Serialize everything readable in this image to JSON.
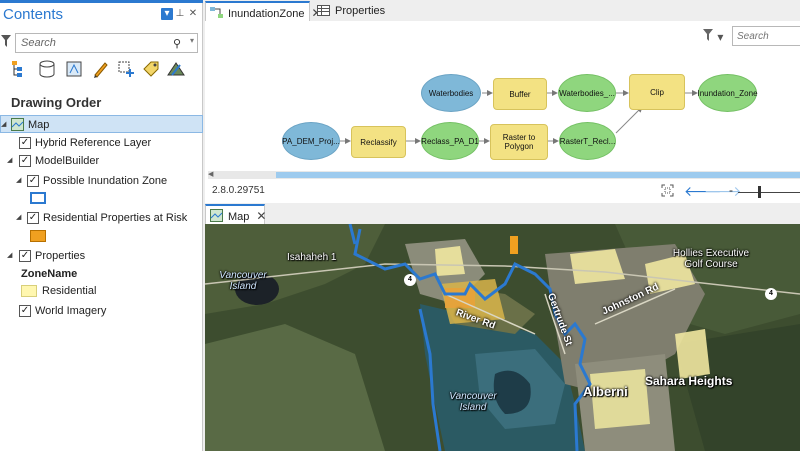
{
  "contents": {
    "title": "Contents",
    "search_placeholder": "Search",
    "drawing_order": "Drawing Order",
    "tree": {
      "map": "Map",
      "hybrid": "Hybrid Reference Layer",
      "modelbuilder": "ModelBuilder",
      "possible_inundation": "Possible Inundation Zone",
      "residential_risk": "Residential Properties at Risk",
      "properties": "Properties",
      "zonename": "ZoneName",
      "residential": "Residential",
      "world_imagery": "World Imagery"
    },
    "colors": {
      "inundation_outline": "#2b79d0",
      "residential_risk_fill": "#f0a020",
      "residential_fill": "#fff7b0"
    }
  },
  "tabs": {
    "model": "InundationZone",
    "properties": "Properties",
    "map": "Map"
  },
  "model": {
    "search_placeholder": "Search",
    "version": "2.8.0.29751",
    "nodes": {
      "waterbodies": "Waterbodies",
      "buffer": "Buffer",
      "waterbodies_out": "Waterbodies_...",
      "clip": "Clip",
      "inundation_zone": "Inundation_Zone",
      "pa_dem": "PA_DEM_Proj...",
      "reclassify": "Reclassify",
      "reclass_pa": "Reclass_PA_D1",
      "raster_to_polygon": "Raster to Polygon",
      "rastert": "RasterT_Recl..."
    }
  },
  "map": {
    "labels": {
      "isahaheh": "Isahaheh 1",
      "vancouver_island_1": "Vancouver Island",
      "vancouver_island_2": "Vancouver Island",
      "river_rd": "River Rd",
      "gertrude": "Gertrude St",
      "johnston": "Johnston Rd",
      "alberni": "Alberni",
      "sahara": "Sahara Heights",
      "hollies": "Hollies Executive Golf Course",
      "hwy_a": "4",
      "hwy_b": "4"
    }
  }
}
